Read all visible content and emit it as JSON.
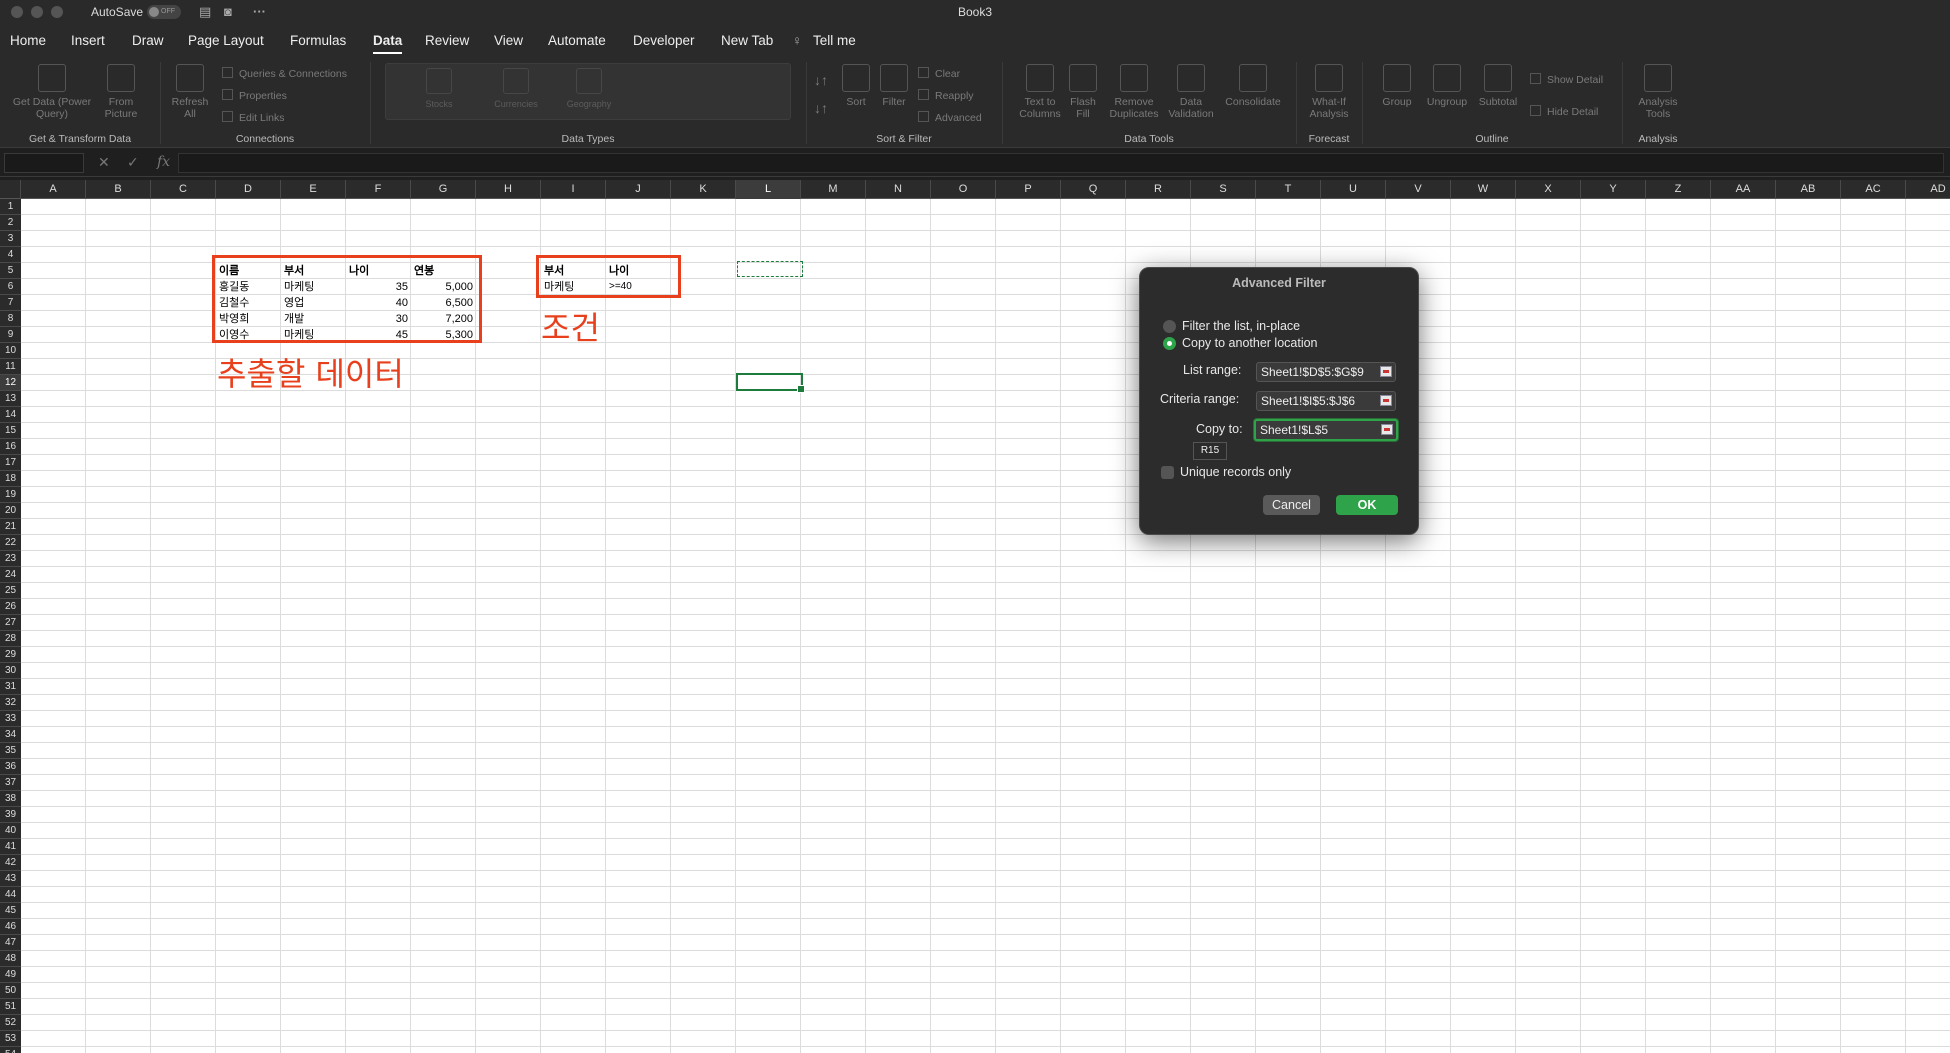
{
  "titlebar": {
    "autosave": "AutoSave",
    "toggle": "OFF",
    "more": "···",
    "title": "Book3"
  },
  "menu": [
    "Home",
    "Insert",
    "Draw",
    "Page Layout",
    "Formulas",
    "Data",
    "Review",
    "View",
    "Automate",
    "Developer",
    "New Tab",
    "Tell me"
  ],
  "ribbon": {
    "get_data": "Get Data (Power Query)",
    "from_picture": "From Picture",
    "refresh_all": "Refresh All",
    "queries": "Queries & Connections",
    "properties": "Properties",
    "edit_links": "Edit Links",
    "stocks": "Stocks",
    "currencies": "Currencies",
    "geography": "Geography",
    "sort": "Sort",
    "filter": "Filter",
    "clear": "Clear",
    "reapply": "Reapply",
    "advanced": "Advanced",
    "text_to_columns": "Text to Columns",
    "flash_fill": "Flash Fill",
    "remove_duplicates": "Remove Duplicates",
    "data_validation": "Data Validation",
    "consolidate": "Consolidate",
    "what_if": "What-If Analysis",
    "group": "Group",
    "ungroup": "Ungroup",
    "subtotal": "Subtotal",
    "show_detail": "Show Detail",
    "hide_detail": "Hide Detail",
    "analysis_tools": "Analysis Tools",
    "groups": {
      "get_transform": "Get & Transform Data",
      "connections": "Connections",
      "data_types": "Data Types",
      "sort_filter": "Sort & Filter",
      "data_tools": "Data Tools",
      "forecast": "Forecast",
      "outline": "Outline",
      "analysis": "Analysis"
    }
  },
  "formula_bar": {
    "fx": "fx",
    "value": ""
  },
  "columns": [
    "A",
    "B",
    "C",
    "D",
    "E",
    "F",
    "G",
    "H",
    "I",
    "J",
    "K",
    "L",
    "M",
    "N",
    "O",
    "P",
    "Q",
    "R",
    "S",
    "T",
    "U",
    "V",
    "W",
    "X",
    "Y",
    "Z",
    "AA",
    "AB",
    "AC",
    "AD"
  ],
  "selected_column": "L",
  "selected_row": "12",
  "data_table": {
    "headers": [
      "이름",
      "부서",
      "나이",
      "연봉"
    ],
    "rows": [
      [
        "홍길동",
        "마케팅",
        "35",
        "5,000"
      ],
      [
        "김철수",
        "영업",
        "40",
        "6,500"
      ],
      [
        "박영희",
        "개발",
        "30",
        "7,200"
      ],
      [
        "이영수",
        "마케팅",
        "45",
        "5,300"
      ]
    ]
  },
  "criteria_table": {
    "headers": [
      "부서",
      "나이"
    ],
    "row": [
      "마케팅",
      ">=40"
    ]
  },
  "annotations": {
    "data_label": "추출할 데이터",
    "criteria_label": "조건"
  },
  "dialog": {
    "title": "Advanced Filter",
    "option_inplace": "Filter the list, in-place",
    "option_copy": "Copy to another location",
    "selected_option": "copy",
    "list_range_label": "List range:",
    "list_range": "Sheet1!$D$5:$G$9",
    "criteria_range_label": "Criteria range:",
    "criteria_range": "Sheet1!$I$5:$J$6",
    "copy_to_label": "Copy to:",
    "copy_to": "Sheet1!$L$5",
    "tooltip": "R15",
    "unique_label": "Unique records only",
    "unique_checked": false,
    "cancel": "Cancel",
    "ok": "OK"
  }
}
